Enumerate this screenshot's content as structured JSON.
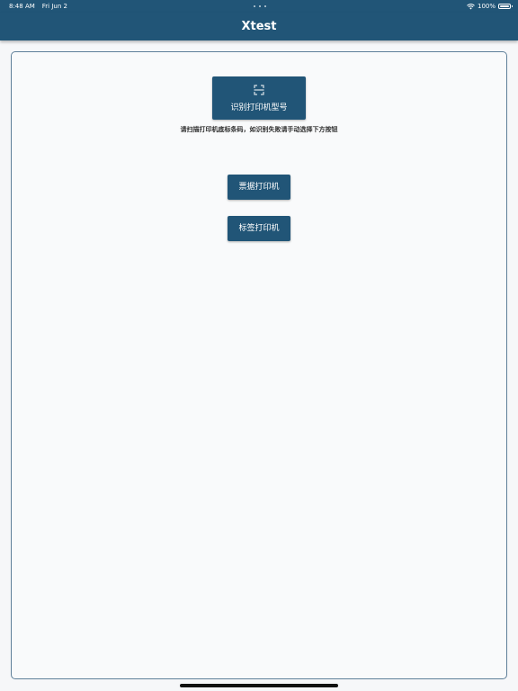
{
  "status_bar": {
    "time": "8:48 AM",
    "date": "Fri Jun 2",
    "battery": "100%"
  },
  "app_bar": {
    "title": "Xtest"
  },
  "scan": {
    "button_label": "识别打印机型号",
    "icon": "scan-icon",
    "hint": "请扫描打印机底标条码，如识别失败请手动选择下方按钮"
  },
  "printers": {
    "receipt_label": "票据打印机",
    "label_label": "标签打印机"
  },
  "colors": {
    "primary": "#215577",
    "background": "#f6f7f9",
    "card_border": "#5e7f99"
  }
}
